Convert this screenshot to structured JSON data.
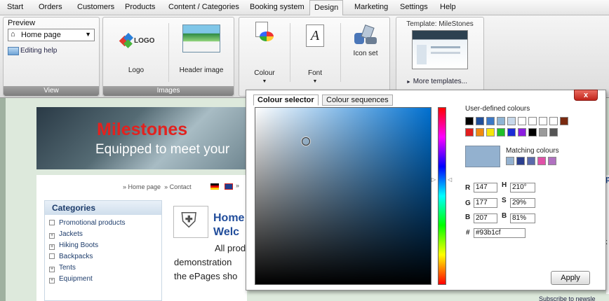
{
  "menu": [
    "Start",
    "Orders",
    "Customers",
    "Products",
    "Content / Categories",
    "Booking system",
    "Design",
    "Marketing",
    "Settings",
    "Help"
  ],
  "ribbon": {
    "preview_label": "Preview",
    "preview_select": "Home page",
    "editing_help": "Editing help",
    "view_group": "View",
    "logo_text": "LOGO",
    "logo_label": "Logo",
    "header_image_label": "Header image",
    "images_group": "Images",
    "colour_label": "Colour",
    "font_label": "Font",
    "font_glyph": "A",
    "icon_set_label": "Icon set",
    "template_label": "Template: MileStones",
    "more_templates": "More templates..."
  },
  "page": {
    "banner_title": "Milestones",
    "banner_sub": "Equipped to meet your",
    "breadcrumb_home": "» Home page",
    "breadcrumb_contact": "» Contact",
    "breadcrumb_more": "»",
    "categories_title": "Categories",
    "categories": [
      {
        "box": "",
        "label": "Promotional products"
      },
      {
        "box": "+",
        "label": "Jackets"
      },
      {
        "box": "+",
        "label": "Hiking Boots"
      },
      {
        "box": "",
        "label": "Backpacks"
      },
      {
        "box": "+",
        "label": "Tents"
      },
      {
        "box": "+",
        "label": "Equipment"
      }
    ],
    "heading1": "Home",
    "heading2": "Welc",
    "text1": "All prod",
    "text2": "demonstration",
    "text3": "the ePages sho",
    "right_bar": "Subscribe to newsle",
    "right_ep": "ep",
    "right_k": "k"
  },
  "dialog": {
    "close": "x",
    "tab_selector": "Colour selector",
    "tab_sequences": "Colour sequences",
    "user_defined_label": "User-defined colours",
    "matching_label": "Matching colours",
    "user_colours_row1": [
      "#000000",
      "#1f4e99",
      "#3b78c6",
      "#8fb4d4",
      "#c7d8ea",
      "#ffffff",
      "#ffffff",
      "#ffffff",
      "#ffffff",
      "#7a2a10"
    ],
    "user_colours_row2": [
      "#e11d1d",
      "#f08a10",
      "#f5e50b",
      "#1fbf2a",
      "#1b2bd6",
      "#8b1de0",
      "#000000",
      "#9a9a9a",
      "#555555"
    ],
    "matching_colours": [
      "#93b1cf",
      "#2b3f8f",
      "#5a6aaa",
      "#e052a8",
      "#b071c0"
    ],
    "selected_hex_colour": "#93b1cf",
    "fields": {
      "r_label": "R",
      "r_value": "147",
      "g_label": "G",
      "g_value": "177",
      "b_label": "B",
      "b_value": "207",
      "h_label": "H",
      "h_value": "210°",
      "s_label": "S",
      "s_value": "29%",
      "br_label": "B",
      "br_value": "81%",
      "hex_label": "#",
      "hex_value": "#93b1cf"
    },
    "apply": "Apply"
  }
}
